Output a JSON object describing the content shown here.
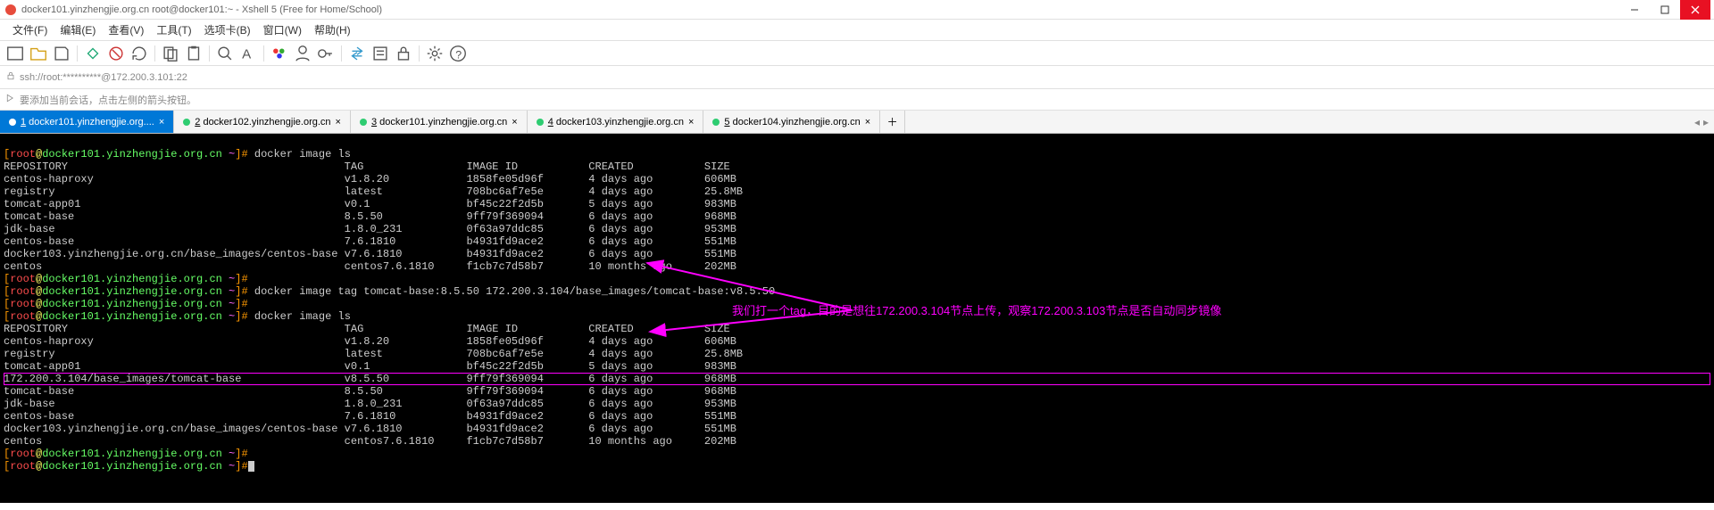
{
  "window": {
    "title": "docker101.yinzhengjie.org.cn    root@docker101:~ - Xshell 5 (Free for Home/School)"
  },
  "menu": {
    "file": "文件(F)",
    "edit": "编辑(E)",
    "view": "查看(V)",
    "tools": "工具(T)",
    "tabs": "选项卡(B)",
    "window": "窗口(W)",
    "help": "帮助(H)"
  },
  "address": {
    "text": "ssh://root:**********@172.200.3.101:22"
  },
  "hint": {
    "text": "要添加当前会话，点击左侧的箭头按钮。"
  },
  "tabs": [
    {
      "num": "1",
      "label": "docker101.yinzhengjie.org....",
      "active": true
    },
    {
      "num": "2",
      "label": "docker102.yinzhengjie.org.cn",
      "active": false
    },
    {
      "num": "3",
      "label": "docker101.yinzhengjie.org.cn",
      "active": false
    },
    {
      "num": "4",
      "label": "docker103.yinzhengjie.org.cn",
      "active": false
    },
    {
      "num": "5",
      "label": "docker104.yinzhengjie.org.cn",
      "active": false
    }
  ],
  "prompt": {
    "lb": "[",
    "user": "root",
    "at": "@",
    "host": "docker101.yinzhengjie.org.cn",
    "path": " ~",
    "rb": "]",
    "hash": "#"
  },
  "commands": {
    "ls1": " docker image ls",
    "tag": " docker image tag tomcat-base:8.5.50 172.200.3.104/base_images/tomcat-base:v8.5.50",
    "ls2": " docker image ls"
  },
  "header": {
    "repo": "REPOSITORY",
    "tag": "TAG",
    "image_id": "IMAGE ID",
    "created": "CREATED",
    "size": "SIZE"
  },
  "list1": [
    {
      "repo": "centos-haproxy",
      "tag": "v1.8.20",
      "id": "1858fe05d96f",
      "created": "4 days ago",
      "size": "606MB"
    },
    {
      "repo": "registry",
      "tag": "latest",
      "id": "708bc6af7e5e",
      "created": "4 days ago",
      "size": "25.8MB"
    },
    {
      "repo": "tomcat-app01",
      "tag": "v0.1",
      "id": "bf45c22f2d5b",
      "created": "5 days ago",
      "size": "983MB"
    },
    {
      "repo": "tomcat-base",
      "tag": "8.5.50",
      "id": "9ff79f369094",
      "created": "6 days ago",
      "size": "968MB"
    },
    {
      "repo": "jdk-base",
      "tag": "1.8.0_231",
      "id": "0f63a97ddc85",
      "created": "6 days ago",
      "size": "953MB"
    },
    {
      "repo": "centos-base",
      "tag": "7.6.1810",
      "id": "b4931fd9ace2",
      "created": "6 days ago",
      "size": "551MB"
    },
    {
      "repo": "docker103.yinzhengjie.org.cn/base_images/centos-base",
      "tag": "v7.6.1810",
      "id": "b4931fd9ace2",
      "created": "6 days ago",
      "size": "551MB"
    },
    {
      "repo": "centos",
      "tag": "centos7.6.1810",
      "id": "f1cb7c7d58b7",
      "created": "10 months ago",
      "size": "202MB"
    }
  ],
  "list2": [
    {
      "repo": "centos-haproxy",
      "tag": "v1.8.20",
      "id": "1858fe05d96f",
      "created": "4 days ago",
      "size": "606MB"
    },
    {
      "repo": "registry",
      "tag": "latest",
      "id": "708bc6af7e5e",
      "created": "4 days ago",
      "size": "25.8MB"
    },
    {
      "repo": "tomcat-app01",
      "tag": "v0.1",
      "id": "bf45c22f2d5b",
      "created": "5 days ago",
      "size": "983MB"
    },
    {
      "repo": "172.200.3.104/base_images/tomcat-base",
      "tag": "v8.5.50",
      "id": "9ff79f369094",
      "created": "6 days ago",
      "size": "968MB",
      "hl": true
    },
    {
      "repo": "tomcat-base",
      "tag": "8.5.50",
      "id": "9ff79f369094",
      "created": "6 days ago",
      "size": "968MB"
    },
    {
      "repo": "jdk-base",
      "tag": "1.8.0_231",
      "id": "0f63a97ddc85",
      "created": "6 days ago",
      "size": "953MB"
    },
    {
      "repo": "centos-base",
      "tag": "7.6.1810",
      "id": "b4931fd9ace2",
      "created": "6 days ago",
      "size": "551MB"
    },
    {
      "repo": "docker103.yinzhengjie.org.cn/base_images/centos-base",
      "tag": "v7.6.1810",
      "id": "b4931fd9ace2",
      "created": "6 days ago",
      "size": "551MB"
    },
    {
      "repo": "centos",
      "tag": "centos7.6.1810",
      "id": "f1cb7c7d58b7",
      "created": "10 months ago",
      "size": "202MB"
    }
  ],
  "annotation": {
    "text": "我们打一个tag，目的是想往172.200.3.104节点上传，观察172.200.3.103节点是否自动同步镜像"
  }
}
